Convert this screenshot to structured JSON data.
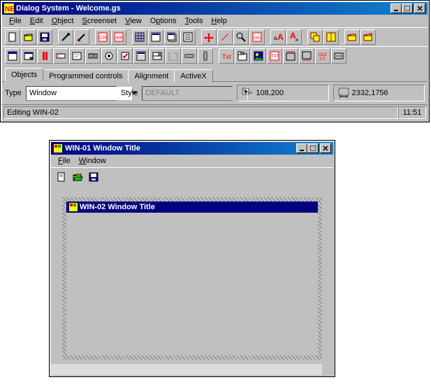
{
  "main_window": {
    "title": "Dialog System - Welcome.gs",
    "menus": [
      "File",
      "Edit",
      "Object",
      "Screenset",
      "View",
      "Options",
      "Tools",
      "Help"
    ],
    "tabs": [
      "Objects",
      "Programmed controls",
      "Alignment",
      "ActiveX"
    ],
    "type_label": "Type",
    "type_value": "Window",
    "style_label": "Style",
    "style_value": "DEFAULT",
    "coords_pos": "108,200",
    "coords_size": "2332,1756",
    "status_text": "Editing WIN-02",
    "status_time": "11:51"
  },
  "child_window": {
    "title": "WIN-01 Window Title",
    "menus": [
      "File",
      "Window"
    ],
    "nested_title": "WIN-02 Window Title"
  }
}
